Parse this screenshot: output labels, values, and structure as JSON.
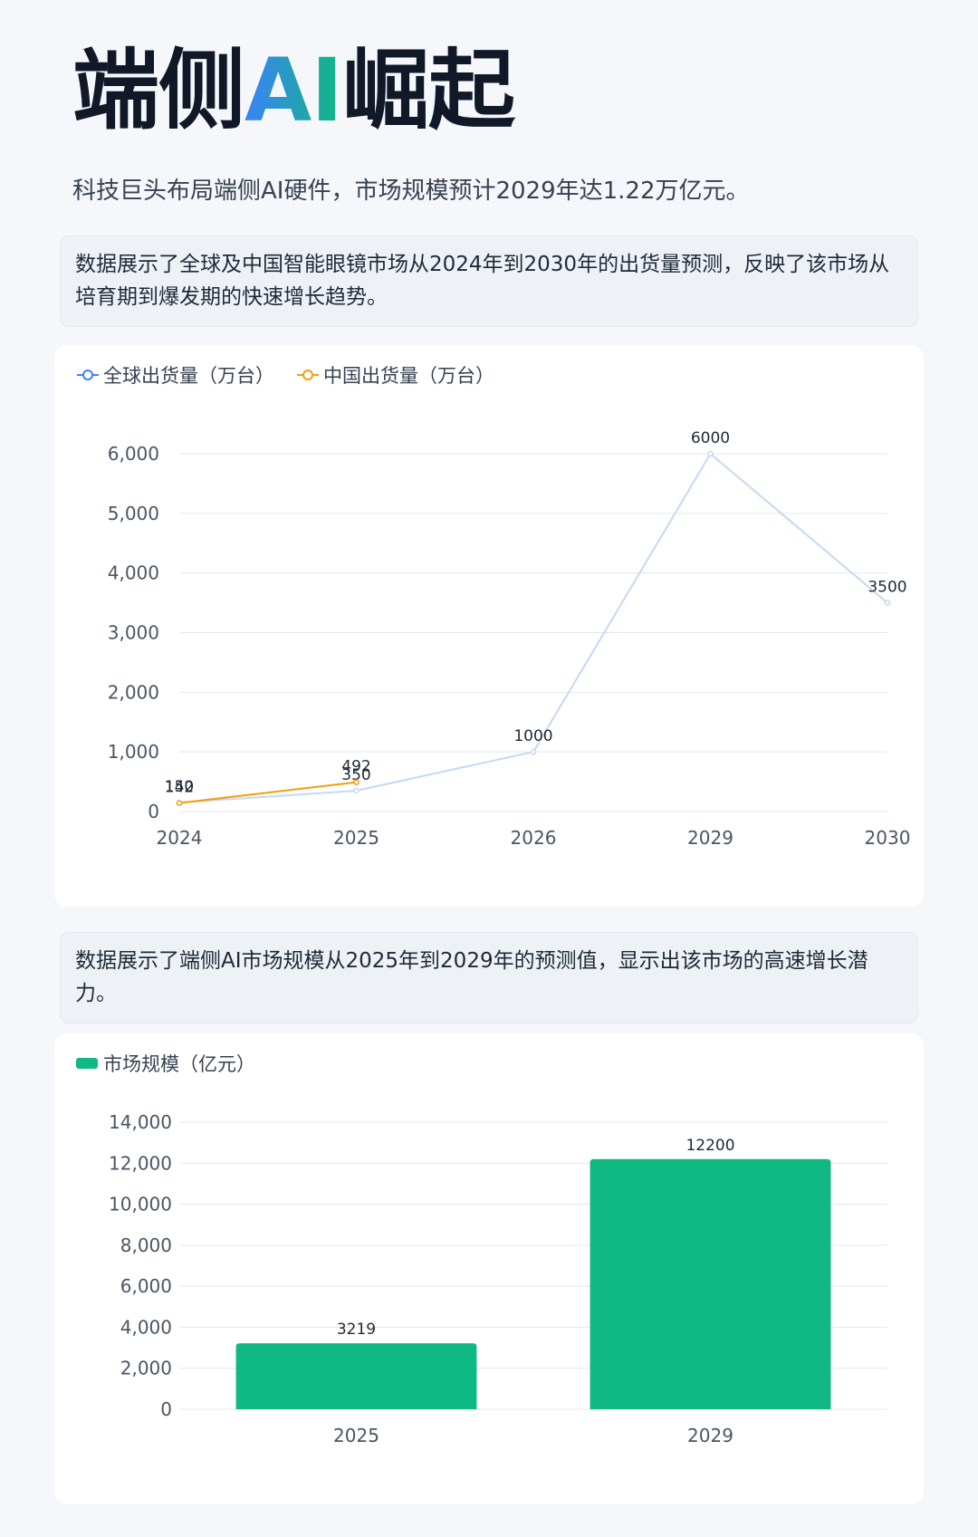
{
  "page": {
    "title_prefix": "端侧",
    "title_accent": "AI",
    "title_suffix": "崛起",
    "subtitle": "科技巨头布局端侧AI硬件，市场规模预计2029年达1.22万亿元。",
    "desc1": "数据展示了全球及中国智能眼镜市场从2024年到2030年的出货量预测，反映了该市场从培育期到爆发期的快速增长趋势。",
    "desc2": "数据展示了端侧AI市场规模从2025年到2029年的预测值，显示出该市场的高速增长潜力。"
  },
  "colors": {
    "global": "#c5d8f5",
    "global_legend": "#3b82f6",
    "china": "#f59e0b",
    "bar": "#10b981",
    "grid": "#e5e7eb"
  },
  "chart_data": [
    {
      "type": "line",
      "categories": [
        "2024",
        "2025",
        "2026",
        "2029",
        "2030"
      ],
      "series": [
        {
          "name": "全球出货量（万台）",
          "values": [
            150,
            350,
            1000,
            6000,
            3500
          ]
        },
        {
          "name": "中国出货量（万台）",
          "values": [
            142,
            492,
            null,
            null,
            null
          ]
        }
      ],
      "ylim": [
        0,
        6000
      ],
      "yticks": [
        0,
        1000,
        2000,
        3000,
        4000,
        5000,
        6000
      ],
      "ytick_labels": [
        "0",
        "1,000",
        "2,000",
        "3,000",
        "4,000",
        "5,000",
        "6,000"
      ],
      "legend": "top-left",
      "grid": true
    },
    {
      "type": "bar",
      "categories": [
        "2025",
        "2029"
      ],
      "series": [
        {
          "name": "市场规模（亿元）",
          "values": [
            3219,
            12200
          ]
        }
      ],
      "ylim": [
        0,
        14000
      ],
      "yticks": [
        0,
        2000,
        4000,
        6000,
        8000,
        10000,
        12000,
        14000
      ],
      "ytick_labels": [
        "0",
        "2,000",
        "4,000",
        "6,000",
        "8,000",
        "10,000",
        "12,000",
        "14,000"
      ],
      "legend": "top-left",
      "grid": true
    }
  ]
}
